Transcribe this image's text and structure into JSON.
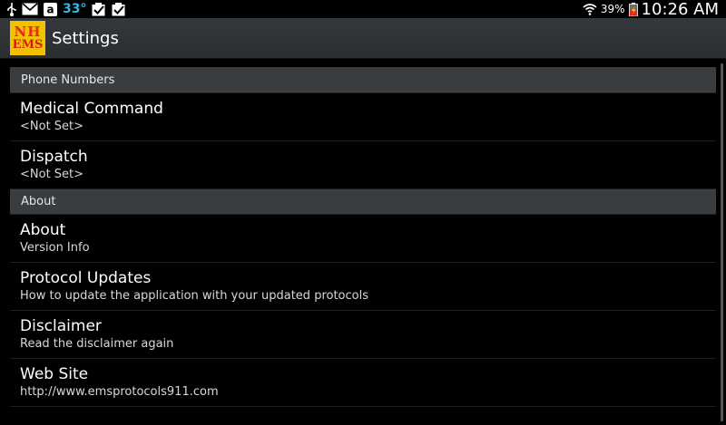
{
  "status_bar": {
    "temperature": "33°",
    "battery": "39%",
    "time": "10:26 AM",
    "left_icons": [
      "usb-icon",
      "mail-icon",
      "amazon-icon",
      "checkbox-icon",
      "checkbox-icon"
    ],
    "right_icons": [
      "wifi-icon",
      "battery-icon"
    ]
  },
  "action_bar": {
    "logo_line1": "NH",
    "logo_line2": "EMS",
    "title": "Settings"
  },
  "sections": {
    "phone_numbers": {
      "header": "Phone Numbers",
      "items": [
        {
          "title": "Medical Command",
          "summary": "<Not Set>"
        },
        {
          "title": "Dispatch",
          "summary": "<Not Set>"
        }
      ]
    },
    "about": {
      "header": "About",
      "items": [
        {
          "title": "About",
          "summary": "Version Info"
        },
        {
          "title": "Protocol Updates",
          "summary": "How to update the application with your updated protocols"
        },
        {
          "title": "Disclaimer",
          "summary": "Read the disclaimer again"
        },
        {
          "title": "Web Site",
          "summary": "http://www.emsprotocols911.com"
        }
      ]
    }
  },
  "colors": {
    "accent_blue": "#33b5e5",
    "background": "#000000",
    "header_bg": "#3a3d40"
  }
}
